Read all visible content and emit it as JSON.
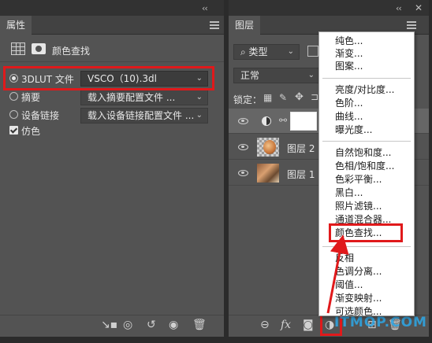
{
  "properties_panel": {
    "tab": "属性",
    "header_title": "颜色查找",
    "rows": [
      {
        "label": "3DLUT 文件",
        "value": "VSCO（10).3dl",
        "selected": true
      },
      {
        "label": "摘要",
        "value": "载入摘要配置文件 ...",
        "selected": false
      },
      {
        "label": "设备链接",
        "value": "载入设备链接配置文件 ...",
        "selected": false
      }
    ],
    "dither_label": "仿色",
    "dither_checked": true
  },
  "layers_panel": {
    "tab": "图层",
    "kind_filter": "类型",
    "blend_mode": "正常",
    "lock_label": "锁定：",
    "layers": [
      {
        "name": "",
        "type": "adjustment"
      },
      {
        "name": "图层 2",
        "type": "image"
      },
      {
        "name": "图层 1",
        "type": "image"
      }
    ]
  },
  "adjustment_menu": {
    "groups": [
      [
        "纯色...",
        "渐变...",
        "图案..."
      ],
      [
        "亮度/对比度...",
        "色阶...",
        "曲线...",
        "曝光度..."
      ],
      [
        "自然饱和度...",
        "色相/饱和度...",
        "色彩平衡...",
        "黑白...",
        "照片滤镜...",
        "通道混合器...",
        "颜色查找..."
      ],
      [
        "反相",
        "色调分离...",
        "阈值...",
        "渐变映射...",
        "可选颜色..."
      ]
    ],
    "highlighted": "颜色查找..."
  },
  "watermark": "ITMOP.COM",
  "colors": {
    "highlight_red": "#e0191b",
    "panel_bg": "#535353"
  }
}
